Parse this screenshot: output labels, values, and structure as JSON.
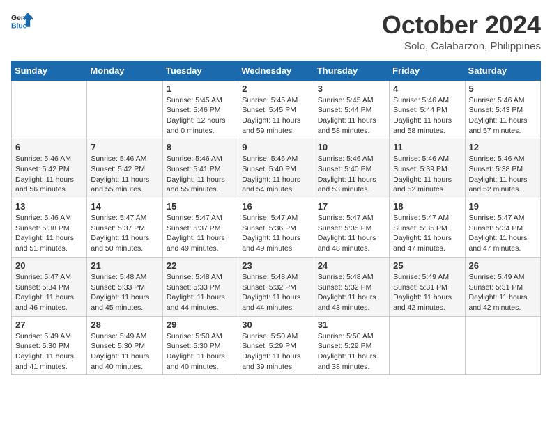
{
  "header": {
    "logo_line1": "General",
    "logo_line2": "Blue",
    "month": "October 2024",
    "location": "Solo, Calabarzon, Philippines"
  },
  "weekdays": [
    "Sunday",
    "Monday",
    "Tuesday",
    "Wednesday",
    "Thursday",
    "Friday",
    "Saturday"
  ],
  "weeks": [
    [
      {
        "day": "",
        "info": ""
      },
      {
        "day": "",
        "info": ""
      },
      {
        "day": "1",
        "info": "Sunrise: 5:45 AM\nSunset: 5:46 PM\nDaylight: 12 hours\nand 0 minutes."
      },
      {
        "day": "2",
        "info": "Sunrise: 5:45 AM\nSunset: 5:45 PM\nDaylight: 11 hours\nand 59 minutes."
      },
      {
        "day": "3",
        "info": "Sunrise: 5:45 AM\nSunset: 5:44 PM\nDaylight: 11 hours\nand 58 minutes."
      },
      {
        "day": "4",
        "info": "Sunrise: 5:46 AM\nSunset: 5:44 PM\nDaylight: 11 hours\nand 58 minutes."
      },
      {
        "day": "5",
        "info": "Sunrise: 5:46 AM\nSunset: 5:43 PM\nDaylight: 11 hours\nand 57 minutes."
      }
    ],
    [
      {
        "day": "6",
        "info": "Sunrise: 5:46 AM\nSunset: 5:42 PM\nDaylight: 11 hours\nand 56 minutes."
      },
      {
        "day": "7",
        "info": "Sunrise: 5:46 AM\nSunset: 5:42 PM\nDaylight: 11 hours\nand 55 minutes."
      },
      {
        "day": "8",
        "info": "Sunrise: 5:46 AM\nSunset: 5:41 PM\nDaylight: 11 hours\nand 55 minutes."
      },
      {
        "day": "9",
        "info": "Sunrise: 5:46 AM\nSunset: 5:40 PM\nDaylight: 11 hours\nand 54 minutes."
      },
      {
        "day": "10",
        "info": "Sunrise: 5:46 AM\nSunset: 5:40 PM\nDaylight: 11 hours\nand 53 minutes."
      },
      {
        "day": "11",
        "info": "Sunrise: 5:46 AM\nSunset: 5:39 PM\nDaylight: 11 hours\nand 52 minutes."
      },
      {
        "day": "12",
        "info": "Sunrise: 5:46 AM\nSunset: 5:38 PM\nDaylight: 11 hours\nand 52 minutes."
      }
    ],
    [
      {
        "day": "13",
        "info": "Sunrise: 5:46 AM\nSunset: 5:38 PM\nDaylight: 11 hours\nand 51 minutes."
      },
      {
        "day": "14",
        "info": "Sunrise: 5:47 AM\nSunset: 5:37 PM\nDaylight: 11 hours\nand 50 minutes."
      },
      {
        "day": "15",
        "info": "Sunrise: 5:47 AM\nSunset: 5:37 PM\nDaylight: 11 hours\nand 49 minutes."
      },
      {
        "day": "16",
        "info": "Sunrise: 5:47 AM\nSunset: 5:36 PM\nDaylight: 11 hours\nand 49 minutes."
      },
      {
        "day": "17",
        "info": "Sunrise: 5:47 AM\nSunset: 5:35 PM\nDaylight: 11 hours\nand 48 minutes."
      },
      {
        "day": "18",
        "info": "Sunrise: 5:47 AM\nSunset: 5:35 PM\nDaylight: 11 hours\nand 47 minutes."
      },
      {
        "day": "19",
        "info": "Sunrise: 5:47 AM\nSunset: 5:34 PM\nDaylight: 11 hours\nand 47 minutes."
      }
    ],
    [
      {
        "day": "20",
        "info": "Sunrise: 5:47 AM\nSunset: 5:34 PM\nDaylight: 11 hours\nand 46 minutes."
      },
      {
        "day": "21",
        "info": "Sunrise: 5:48 AM\nSunset: 5:33 PM\nDaylight: 11 hours\nand 45 minutes."
      },
      {
        "day": "22",
        "info": "Sunrise: 5:48 AM\nSunset: 5:33 PM\nDaylight: 11 hours\nand 44 minutes."
      },
      {
        "day": "23",
        "info": "Sunrise: 5:48 AM\nSunset: 5:32 PM\nDaylight: 11 hours\nand 44 minutes."
      },
      {
        "day": "24",
        "info": "Sunrise: 5:48 AM\nSunset: 5:32 PM\nDaylight: 11 hours\nand 43 minutes."
      },
      {
        "day": "25",
        "info": "Sunrise: 5:49 AM\nSunset: 5:31 PM\nDaylight: 11 hours\nand 42 minutes."
      },
      {
        "day": "26",
        "info": "Sunrise: 5:49 AM\nSunset: 5:31 PM\nDaylight: 11 hours\nand 42 minutes."
      }
    ],
    [
      {
        "day": "27",
        "info": "Sunrise: 5:49 AM\nSunset: 5:30 PM\nDaylight: 11 hours\nand 41 minutes."
      },
      {
        "day": "28",
        "info": "Sunrise: 5:49 AM\nSunset: 5:30 PM\nDaylight: 11 hours\nand 40 minutes."
      },
      {
        "day": "29",
        "info": "Sunrise: 5:50 AM\nSunset: 5:30 PM\nDaylight: 11 hours\nand 40 minutes."
      },
      {
        "day": "30",
        "info": "Sunrise: 5:50 AM\nSunset: 5:29 PM\nDaylight: 11 hours\nand 39 minutes."
      },
      {
        "day": "31",
        "info": "Sunrise: 5:50 AM\nSunset: 5:29 PM\nDaylight: 11 hours\nand 38 minutes."
      },
      {
        "day": "",
        "info": ""
      },
      {
        "day": "",
        "info": ""
      }
    ]
  ]
}
